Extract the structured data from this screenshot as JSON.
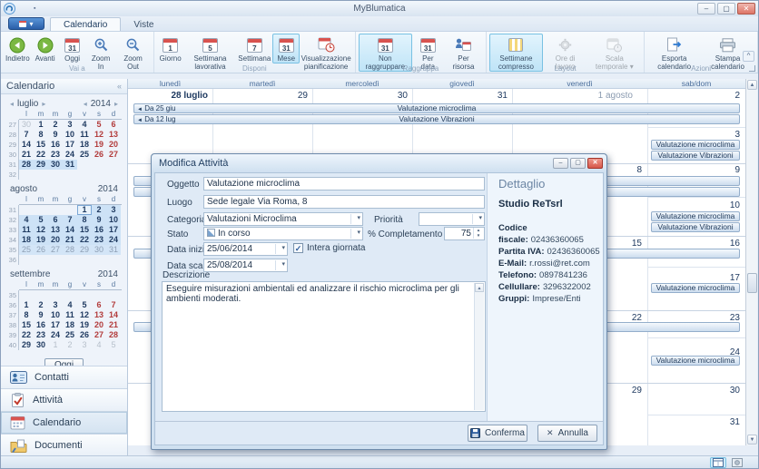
{
  "titlebar": {
    "title": "MyBlumatica"
  },
  "glyphs": {
    "left": "◂",
    "right": "▸",
    "collapse": "«",
    "caret": "▾",
    "banner_arrow": "◄",
    "check": "✓",
    "min": "–",
    "max": "▢",
    "close": "✕",
    "spin_up": "▲",
    "spin_down": "▼",
    "scroll_up": "▲",
    "scroll_down": "▼",
    "ribbon_collapse": "^",
    "qat": "▪"
  },
  "tabs": {
    "calendario": "Calendario",
    "viste": "Viste"
  },
  "ribbon": {
    "vai_a": {
      "label": "Vai a",
      "buttons": [
        "Indietro",
        "Avanti",
        "Oggi",
        "Zoom In",
        "Zoom Out"
      ]
    },
    "disponi": {
      "label": "Disponi",
      "buttons": [
        "Giorno",
        "Settimana lavorativa",
        "Settimana",
        "Mese",
        "Visualizzazione pianificazione"
      ]
    },
    "raggruppa": {
      "label": "Raggruppa",
      "buttons": [
        "Non raggruppare",
        "Per data",
        "Per risorsa"
      ]
    },
    "layout": {
      "label": "Layout",
      "buttons": [
        "Settimane compresso",
        "Ore di lavoro",
        "Scala temporale"
      ]
    },
    "azioni": {
      "label": "Azioni",
      "buttons": [
        "Esporta calendario",
        "Stampa calendario"
      ]
    },
    "icon_numbers": {
      "giorno": "1",
      "sett_lav": "5",
      "settimana": "7",
      "mese": "31",
      "non_ragg": "31",
      "per_data": "31",
      "oggi": "31"
    }
  },
  "sidebar": {
    "header": "Calendario",
    "months": [
      {
        "name": "luglio",
        "year": "2014",
        "dows": [
          "l",
          "m",
          "m",
          "g",
          "v",
          "s",
          "d"
        ],
        "cells": [
          {
            "t": "27",
            "c": "wk"
          },
          {
            "t": "30",
            "c": "out"
          },
          {
            "t": "1",
            "c": "wd"
          },
          {
            "t": "2",
            "c": "wd"
          },
          {
            "t": "3",
            "c": "wd"
          },
          {
            "t": "4",
            "c": "wd"
          },
          {
            "t": "5",
            "c": "we"
          },
          {
            "t": "6",
            "c": "we"
          },
          {
            "t": "28",
            "c": "wk"
          },
          {
            "t": "7",
            "c": "wd"
          },
          {
            "t": "8",
            "c": "wd"
          },
          {
            "t": "9",
            "c": "wd"
          },
          {
            "t": "10",
            "c": "wd"
          },
          {
            "t": "11",
            "c": "wd"
          },
          {
            "t": "12",
            "c": "we"
          },
          {
            "t": "13",
            "c": "we"
          },
          {
            "t": "29",
            "c": "wk"
          },
          {
            "t": "14",
            "c": "wd"
          },
          {
            "t": "15",
            "c": "wd"
          },
          {
            "t": "16",
            "c": "wd"
          },
          {
            "t": "17",
            "c": "wd"
          },
          {
            "t": "18",
            "c": "wd"
          },
          {
            "t": "19",
            "c": "we"
          },
          {
            "t": "20",
            "c": "we"
          },
          {
            "t": "30",
            "c": "wk"
          },
          {
            "t": "21",
            "c": "wd"
          },
          {
            "t": "22",
            "c": "wd"
          },
          {
            "t": "23",
            "c": "wd"
          },
          {
            "t": "24",
            "c": "wd"
          },
          {
            "t": "25",
            "c": "wd"
          },
          {
            "t": "26",
            "c": "we"
          },
          {
            "t": "27",
            "c": "we"
          },
          {
            "t": "31",
            "c": "wk"
          },
          {
            "t": "28",
            "c": "sel"
          },
          {
            "t": "29",
            "c": "sel"
          },
          {
            "t": "30",
            "c": "sel"
          },
          {
            "t": "31",
            "c": "sel"
          },
          {
            "t": "",
            "c": "bl"
          },
          {
            "t": "",
            "c": "bl"
          },
          {
            "t": "",
            "c": "bl"
          },
          {
            "t": "32",
            "c": "wk"
          },
          {
            "t": "",
            "c": "bl"
          },
          {
            "t": "",
            "c": "bl"
          },
          {
            "t": "",
            "c": "bl"
          },
          {
            "t": "",
            "c": "bl"
          },
          {
            "t": "",
            "c": "bl"
          },
          {
            "t": "",
            "c": "bl"
          },
          {
            "t": "",
            "c": "bl"
          }
        ]
      },
      {
        "name": "agosto",
        "year": "2014",
        "dows": [
          "l",
          "m",
          "m",
          "g",
          "v",
          "s",
          "d"
        ],
        "cells": [
          {
            "t": "31",
            "c": "wk"
          },
          {
            "t": "",
            "c": "bl"
          },
          {
            "t": "",
            "c": "bl"
          },
          {
            "t": "",
            "c": "bl"
          },
          {
            "t": "",
            "c": "bl"
          },
          {
            "t": "1",
            "c": "self"
          },
          {
            "t": "2",
            "c": "sel"
          },
          {
            "t": "3",
            "c": "sel"
          },
          {
            "t": "32",
            "c": "wk"
          },
          {
            "t": "4",
            "c": "sel"
          },
          {
            "t": "5",
            "c": "sel"
          },
          {
            "t": "6",
            "c": "sel"
          },
          {
            "t": "7",
            "c": "sel"
          },
          {
            "t": "8",
            "c": "sel"
          },
          {
            "t": "9",
            "c": "sel"
          },
          {
            "t": "10",
            "c": "sel"
          },
          {
            "t": "33",
            "c": "wk"
          },
          {
            "t": "11",
            "c": "sel"
          },
          {
            "t": "12",
            "c": "sel"
          },
          {
            "t": "13",
            "c": "sel"
          },
          {
            "t": "14",
            "c": "sel"
          },
          {
            "t": "15",
            "c": "sel"
          },
          {
            "t": "16",
            "c": "sel"
          },
          {
            "t": "17",
            "c": "sel"
          },
          {
            "t": "34",
            "c": "wk"
          },
          {
            "t": "18",
            "c": "sel"
          },
          {
            "t": "19",
            "c": "sel"
          },
          {
            "t": "20",
            "c": "sel"
          },
          {
            "t": "21",
            "c": "sel"
          },
          {
            "t": "22",
            "c": "sel"
          },
          {
            "t": "23",
            "c": "sel"
          },
          {
            "t": "24",
            "c": "sel"
          },
          {
            "t": "35",
            "c": "wk"
          },
          {
            "t": "25",
            "c": "selo"
          },
          {
            "t": "26",
            "c": "selo"
          },
          {
            "t": "27",
            "c": "selo"
          },
          {
            "t": "28",
            "c": "selo"
          },
          {
            "t": "29",
            "c": "selo"
          },
          {
            "t": "30",
            "c": "selo"
          },
          {
            "t": "31",
            "c": "selo"
          },
          {
            "t": "36",
            "c": "wk"
          },
          {
            "t": "",
            "c": "bl"
          },
          {
            "t": "",
            "c": "bl"
          },
          {
            "t": "",
            "c": "bl"
          },
          {
            "t": "",
            "c": "bl"
          },
          {
            "t": "",
            "c": "bl"
          },
          {
            "t": "",
            "c": "bl"
          },
          {
            "t": "",
            "c": "bl"
          }
        ]
      },
      {
        "name": "settembre",
        "year": "2014",
        "dows": [
          "l",
          "m",
          "m",
          "g",
          "v",
          "s",
          "d"
        ],
        "cells": [
          {
            "t": "35",
            "c": "wk"
          },
          {
            "t": "",
            "c": "bl"
          },
          {
            "t": "",
            "c": "bl"
          },
          {
            "t": "",
            "c": "bl"
          },
          {
            "t": "",
            "c": "bl"
          },
          {
            "t": "",
            "c": "bl"
          },
          {
            "t": "",
            "c": "bl"
          },
          {
            "t": "",
            "c": "bl"
          },
          {
            "t": "36",
            "c": "wk"
          },
          {
            "t": "1",
            "c": "wd"
          },
          {
            "t": "2",
            "c": "wd"
          },
          {
            "t": "3",
            "c": "wd"
          },
          {
            "t": "4",
            "c": "wd"
          },
          {
            "t": "5",
            "c": "wd"
          },
          {
            "t": "6",
            "c": "we"
          },
          {
            "t": "7",
            "c": "we"
          },
          {
            "t": "37",
            "c": "wk"
          },
          {
            "t": "8",
            "c": "wd"
          },
          {
            "t": "9",
            "c": "wd"
          },
          {
            "t": "10",
            "c": "wd"
          },
          {
            "t": "11",
            "c": "wd"
          },
          {
            "t": "12",
            "c": "wd"
          },
          {
            "t": "13",
            "c": "we"
          },
          {
            "t": "14",
            "c": "we"
          },
          {
            "t": "38",
            "c": "wk"
          },
          {
            "t": "15",
            "c": "wd"
          },
          {
            "t": "16",
            "c": "wd"
          },
          {
            "t": "17",
            "c": "wd"
          },
          {
            "t": "18",
            "c": "wd"
          },
          {
            "t": "19",
            "c": "wd"
          },
          {
            "t": "20",
            "c": "we"
          },
          {
            "t": "21",
            "c": "we"
          },
          {
            "t": "39",
            "c": "wk"
          },
          {
            "t": "22",
            "c": "wd"
          },
          {
            "t": "23",
            "c": "wd"
          },
          {
            "t": "24",
            "c": "wd"
          },
          {
            "t": "25",
            "c": "wd"
          },
          {
            "t": "26",
            "c": "wd"
          },
          {
            "t": "27",
            "c": "we"
          },
          {
            "t": "28",
            "c": "we"
          },
          {
            "t": "40",
            "c": "wk"
          },
          {
            "t": "29",
            "c": "wd"
          },
          {
            "t": "30",
            "c": "wd"
          },
          {
            "t": "1",
            "c": "out"
          },
          {
            "t": "2",
            "c": "out"
          },
          {
            "t": "3",
            "c": "out"
          },
          {
            "t": "4",
            "c": "out"
          },
          {
            "t": "5",
            "c": "out"
          }
        ]
      }
    ],
    "today": "Oggi",
    "nav": [
      "Contatti",
      "Attività",
      "Calendario",
      "Documenti"
    ]
  },
  "grid": {
    "day_headers": [
      "lunedì",
      "martedì",
      "mercoledì",
      "giovedì",
      "venerdì",
      "sab/dom"
    ],
    "dates": [
      "28 luglio",
      "29",
      "30",
      "31",
      "1 agosto",
      "2",
      "3",
      "8",
      "9",
      "10",
      "15",
      "16",
      "17",
      "22",
      "23",
      "24",
      "29",
      "30",
      "31"
    ],
    "banners": [
      {
        "prefix": "Da 25 giu",
        "label": "Valutazione microclima"
      },
      {
        "prefix": "Da 12 lug",
        "label": "Valutazione Vibrazioni"
      }
    ],
    "events": [
      "Valutazione microclima",
      "Valutazione Vibrazioni",
      "Valutazione microclima",
      "Valutazione Vibrazioni",
      "Valutazione microclima",
      "Valutazione microclima"
    ]
  },
  "dialog": {
    "title": "Modifica Attività",
    "labels": {
      "oggetto": "Oggetto",
      "luogo": "Luogo",
      "categoria": "Categoria",
      "priorita": "Priorità",
      "stato": "Stato",
      "completamento": "% Completamento",
      "data_inizio": "Data inizio",
      "intera": "Intera giornata",
      "data_scadenza": "Data scadenza",
      "descrizione": "Descrizione"
    },
    "values": {
      "oggetto": "Valutazione microclima",
      "luogo": "Sede legale Via Roma, 8",
      "categoria": "Valutazioni Microclima",
      "priorita": "",
      "stato": "In corso",
      "completamento": "75",
      "data_inizio": "25/06/2014",
      "data_scadenza": "25/08/2014",
      "descrizione": "Eseguire misurazioni ambientali ed analizzare il rischio microclima per gli ambienti moderati."
    },
    "detail": {
      "title": "Dettaglio",
      "name": "Studio ReTsrl",
      "rows": [
        {
          "label": "Codice fiscale:",
          "value": "02436360065"
        },
        {
          "label": "Partita IVA:",
          "value": "02436360065"
        },
        {
          "label": "E-Mail:",
          "value": "r.rossi@ret.com"
        },
        {
          "label": "Telefono:",
          "value": "0897841236"
        },
        {
          "label": "Cellullare:",
          "value": "3296322002"
        },
        {
          "label": "Gruppi:",
          "value": "Imprese/Enti"
        }
      ]
    },
    "buttons": {
      "confirm": "Conferma",
      "cancel": "Annulla"
    }
  }
}
